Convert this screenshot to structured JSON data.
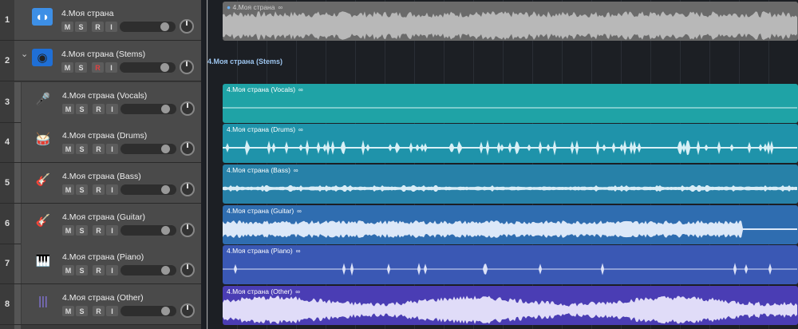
{
  "tracks": [
    {
      "number": "1",
      "name": "4.Моя страна",
      "icon": "audio-waveform-icon",
      "region_color": "#6a6a6a",
      "wave_color": "#b8b8b8",
      "wave": "dense",
      "loop_symbol": "∞",
      "dot": true
    },
    {
      "number": "2",
      "name": "4.Моя страна (Stems)",
      "icon": "track-stack-icon",
      "region_label": "4.Моя страна (Stems)",
      "record_armed": true
    },
    {
      "number": "3",
      "name": "4.Моя страна (Vocals)",
      "icon": "microphone-icon",
      "region_color": "#1fa3a6",
      "wave_color": "#d8f4f4",
      "wave": "flat",
      "loop_symbol": "∞"
    },
    {
      "number": "4",
      "name": "4.Моя страна (Drums)",
      "icon": "drum-kit-icon",
      "region_color": "#1f93aa",
      "wave_color": "#d8f0f6",
      "wave": "spiky",
      "loop_symbol": "∞"
    },
    {
      "number": "5",
      "name": "4.Моя страна (Bass)",
      "icon": "bass-guitar-icon",
      "region_color": "#2781a8",
      "wave_color": "#d8ecf6",
      "wave": "thin",
      "loop_symbol": "∞"
    },
    {
      "number": "6",
      "name": "4.Моя страна (Guitar)",
      "icon": "guitar-icon",
      "region_color": "#2f6db0",
      "wave_color": "#dce8f8",
      "wave": "medium",
      "loop_symbol": "∞"
    },
    {
      "number": "7",
      "name": "4.Моя страна (Piano)",
      "icon": "piano-icon",
      "region_color": "#3a58b4",
      "wave_color": "#dce2f8",
      "wave": "sparse",
      "loop_symbol": "∞"
    },
    {
      "number": "8",
      "name": "4.Моя страна (Other)",
      "icon": "waveform-icon",
      "region_color": "#4a3db4",
      "wave_color": "#e0dcf8",
      "wave": "full",
      "loop_symbol": "∞"
    }
  ],
  "buttons": {
    "mute": "M",
    "solo": "S",
    "record": "R",
    "input": "I"
  },
  "disclosure": "⌄"
}
